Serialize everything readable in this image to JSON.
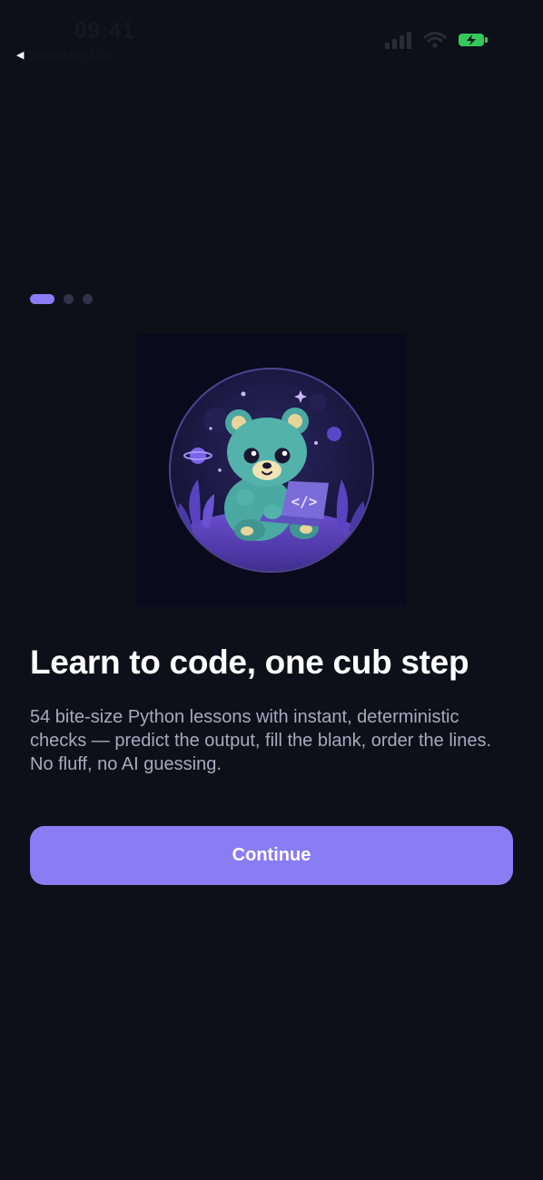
{
  "status_bar": {
    "time": "09:41",
    "back_app": "Stargazer Log",
    "battery_color": "#34c759"
  },
  "onboarding": {
    "page_count": 3,
    "active_page": 1,
    "accent_color": "#8a7cf3",
    "hero_icon": "code-brackets-icon",
    "hero_code_symbol": "</>",
    "title": "Learn to code, one cub step",
    "description": "54 bite-size Python lessons with instant, deterministic checks — predict the output, fill the blank, order the lines. No fluff, no AI guessing.",
    "continue_label": "Continue"
  }
}
